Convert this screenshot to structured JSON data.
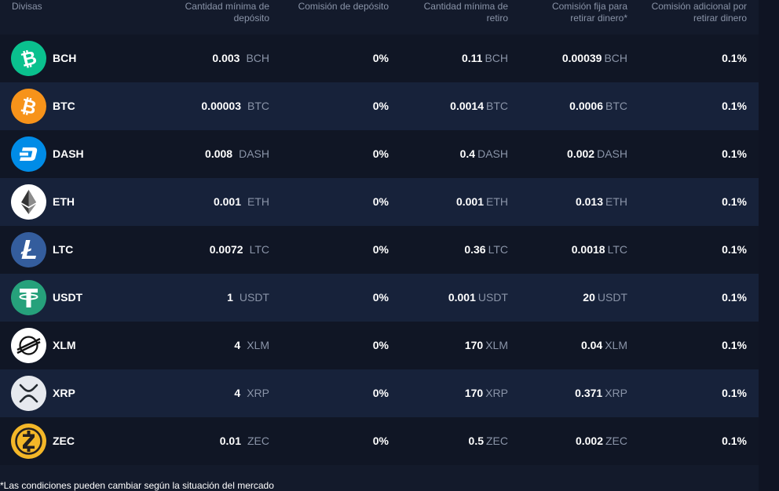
{
  "header": {
    "currency": "Divisas",
    "min_deposit_1": "Cantidad mínima de",
    "min_deposit_2": "depósito",
    "deposit_fee": "Comisión de depósito",
    "min_withdraw_1": "Cantidad mínima de",
    "min_withdraw_2": "retiro",
    "fixed_fee_1": "Comisión fija para",
    "fixed_fee_2": "retirar dinero*",
    "extra_fee_1": "Comisión adicional por",
    "extra_fee_2": "retirar dinero"
  },
  "rows": [
    {
      "name": "BCH",
      "icon": "bitcoin-cash-icon",
      "color": "#0ac18e",
      "min_deposit": "0.003",
      "dep_unit": "BCH",
      "deposit_fee": "0%",
      "min_withdraw": "0.11",
      "wd_unit": "BCH",
      "fixed_fee": "0.00039",
      "fix_unit": "BCH",
      "extra_fee": "0.1%"
    },
    {
      "name": "BTC",
      "icon": "bitcoin-icon",
      "color": "#f7931a",
      "min_deposit": "0.00003",
      "dep_unit": "BTC",
      "deposit_fee": "0%",
      "min_withdraw": "0.0014",
      "wd_unit": "BTC",
      "fixed_fee": "0.0006",
      "fix_unit": "BTC",
      "extra_fee": "0.1%"
    },
    {
      "name": "DASH",
      "icon": "dash-icon",
      "color": "#008ce7",
      "min_deposit": "0.008",
      "dep_unit": "DASH",
      "deposit_fee": "0%",
      "min_withdraw": "0.4",
      "wd_unit": "DASH",
      "fixed_fee": "0.002",
      "fix_unit": "DASH",
      "extra_fee": "0.1%"
    },
    {
      "name": "ETH",
      "icon": "ethereum-icon",
      "color": "#ffffff",
      "min_deposit": "0.001",
      "dep_unit": "ETH",
      "deposit_fee": "0%",
      "min_withdraw": "0.001",
      "wd_unit": "ETH",
      "fixed_fee": "0.013",
      "fix_unit": "ETH",
      "extra_fee": "0.1%"
    },
    {
      "name": "LTC",
      "icon": "litecoin-icon",
      "color": "#345d9d",
      "min_deposit": "0.0072",
      "dep_unit": "LTC",
      "deposit_fee": "0%",
      "min_withdraw": "0.36",
      "wd_unit": "LTC",
      "fixed_fee": "0.0018",
      "fix_unit": "LTC",
      "extra_fee": "0.1%"
    },
    {
      "name": "USDT",
      "icon": "tether-icon",
      "color": "#26a17b",
      "min_deposit": "1",
      "dep_unit": "USDT",
      "deposit_fee": "0%",
      "min_withdraw": "0.001",
      "wd_unit": "USDT",
      "fixed_fee": "20",
      "fix_unit": "USDT",
      "extra_fee": "0.1%"
    },
    {
      "name": "XLM",
      "icon": "stellar-icon",
      "color": "#ffffff",
      "min_deposit": "4",
      "dep_unit": "XLM",
      "deposit_fee": "0%",
      "min_withdraw": "170",
      "wd_unit": "XLM",
      "fixed_fee": "0.04",
      "fix_unit": "XLM",
      "extra_fee": "0.1%"
    },
    {
      "name": "XRP",
      "icon": "ripple-icon",
      "color": "#e6e9ee",
      "min_deposit": "4",
      "dep_unit": "XRP",
      "deposit_fee": "0%",
      "min_withdraw": "170",
      "wd_unit": "XRP",
      "fixed_fee": "0.371",
      "fix_unit": "XRP",
      "extra_fee": "0.1%"
    },
    {
      "name": "ZEC",
      "icon": "zcash-icon",
      "color": "#f4b728",
      "min_deposit": "0.01",
      "dep_unit": "ZEC",
      "deposit_fee": "0%",
      "min_withdraw": "0.5",
      "wd_unit": "ZEC",
      "fixed_fee": "0.002",
      "fix_unit": "ZEC",
      "extra_fee": "0.1%"
    }
  ],
  "footer": {
    "note": "*Las condiciones pueden cambiar según la situación del mercado"
  },
  "colors": {
    "background": "#131a2b",
    "row_dark": "#101625",
    "row_light": "#17223a",
    "muted_text": "#8a94a8"
  }
}
